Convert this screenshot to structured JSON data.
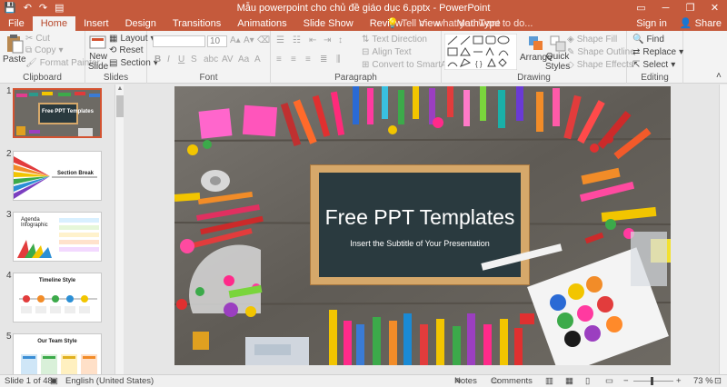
{
  "titlebar": {
    "title": "Mẫu powerpoint cho chủ đề giáo dục 6.pptx  -  PowerPoint",
    "save_icon": "💾",
    "undo_icon": "↶",
    "redo_icon": "↷",
    "present_icon": "▤",
    "minimize": "─",
    "restore": "❐",
    "close": "✕",
    "ribbon_display": "▭"
  },
  "tabs": [
    "File",
    "Home",
    "Insert",
    "Design",
    "Transitions",
    "Animations",
    "Slide Show",
    "Review",
    "View",
    "MathType"
  ],
  "active_tab": "Home",
  "tellme": "Tell me what you want to do...",
  "signin": "Sign in",
  "share": "Share",
  "ribbon": {
    "clipboard": {
      "label": "Clipboard",
      "paste": "Paste",
      "cut": "Cut",
      "copy": "Copy",
      "format_painter": "Format Painter"
    },
    "slides": {
      "label": "Slides",
      "new_slide": "New",
      "new_slide_2": "Slide",
      "layout": "Layout",
      "reset": "Reset",
      "section": "Section"
    },
    "font": {
      "label": "Font",
      "font_name": "",
      "font_size": "10"
    },
    "paragraph": {
      "label": "Paragraph",
      "text_direction": "Text Direction",
      "align_text": "Align Text",
      "convert_smartart": "Convert to SmartArt"
    },
    "drawing": {
      "label": "Drawing",
      "arrange": "Arrange",
      "quick_styles": "Quick",
      "quick_styles_2": "Styles",
      "shape_fill": "Shape Fill",
      "shape_outline": "Shape Outline",
      "shape_effects": "Shape Effects"
    },
    "editing": {
      "label": "Editing",
      "find": "Find",
      "replace": "Replace",
      "select": "Select"
    }
  },
  "thumbnails": [
    {
      "num": "1",
      "text": "Free PPT Templates"
    },
    {
      "num": "2",
      "text": "Section Break"
    },
    {
      "num": "3",
      "text": "Agenda Infographic"
    },
    {
      "num": "4",
      "text": "Timeline Style"
    },
    {
      "num": "5",
      "text": "Our Team Style"
    }
  ],
  "slide": {
    "title": "Free PPT Templates",
    "subtitle": "Insert the Subtitle of Your Presentation"
  },
  "status": {
    "slide_count": "Slide 1 of 48",
    "language": "English (United States)",
    "notes": "Notes",
    "comments": "Comments",
    "zoom": "73 %"
  }
}
